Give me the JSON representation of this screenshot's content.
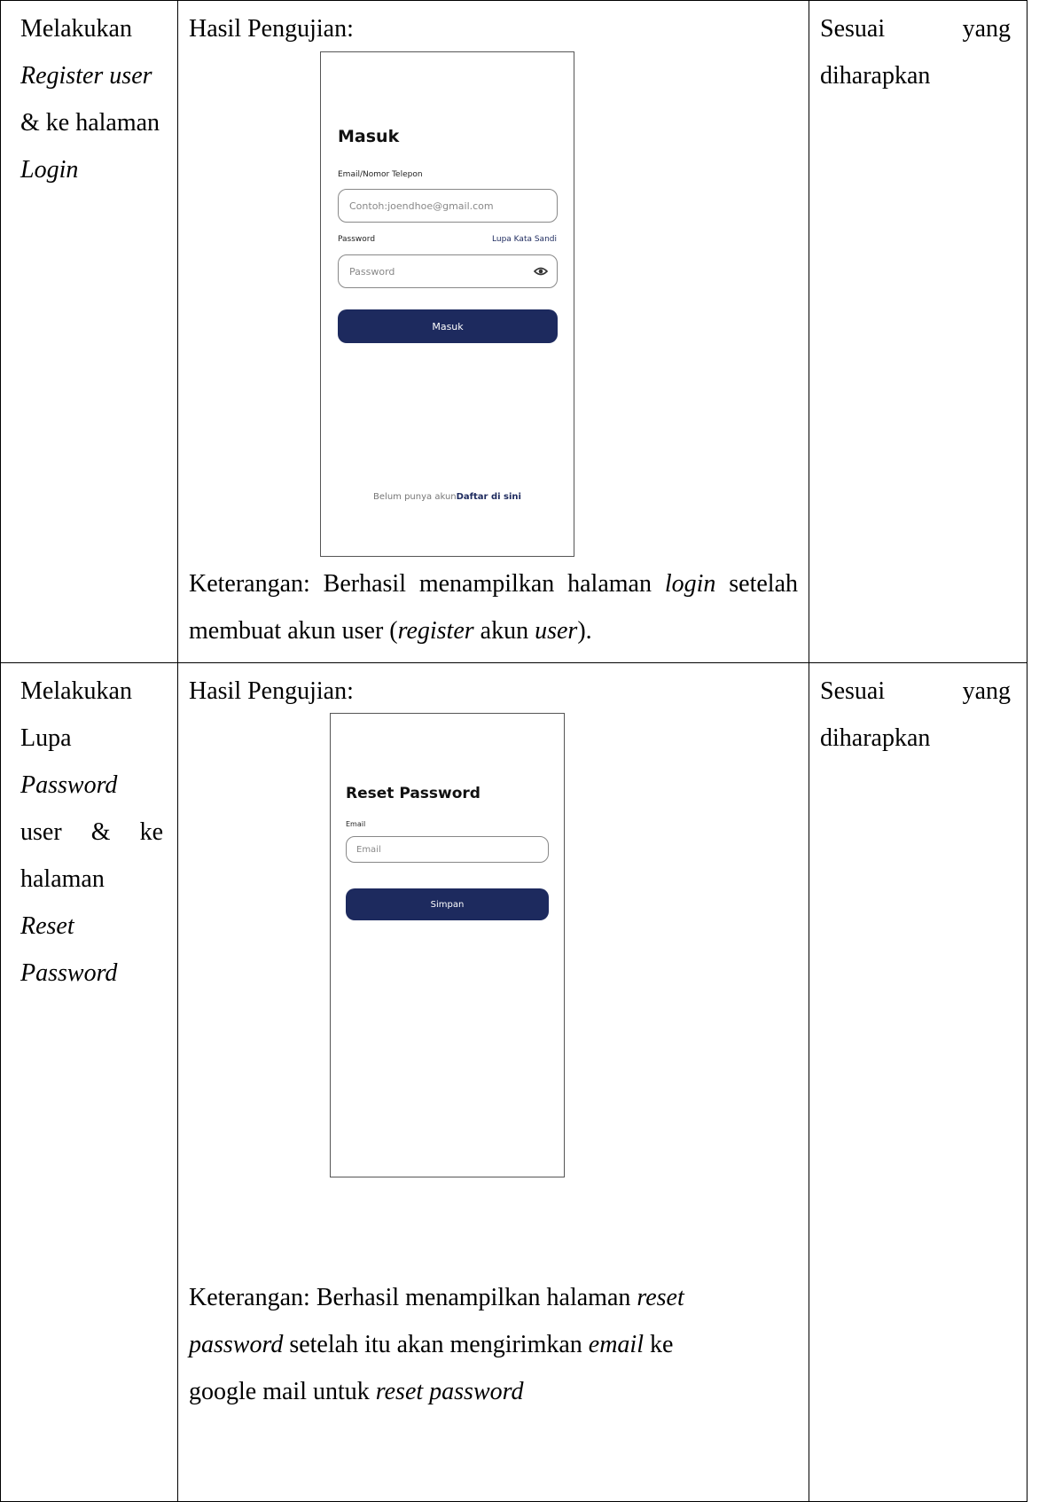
{
  "rows": [
    {
      "scenario": {
        "line1": "Melakukan",
        "line2": "Register user",
        "line3": "& ke halaman",
        "line4": "Login"
      },
      "result_label": "Hasil Pengujian:",
      "phone": {
        "title": "Masuk",
        "email_label": "Email/Nomor Telepon",
        "email_placeholder": "Contoh:joendhoe@gmail.com",
        "password_label": "Password",
        "forgot_link": "Lupa Kata Sandi",
        "password_placeholder": "Password",
        "submit": "Masuk",
        "footer_text": "Belum punya akun",
        "footer_link": "Daftar di sini",
        "eye_icon": "eye-icon"
      },
      "note": {
        "prefix": "Keterangan: Berhasil menampilkan halaman ",
        "login": "login",
        "mid": " setelah membuat akun user (",
        "register": "register",
        "akun": " akun ",
        "user": "user",
        "end": ")."
      },
      "status": {
        "word1": "Sesuai",
        "word2": "yang",
        "word3": "diharapkan"
      }
    },
    {
      "scenario": {
        "line1": "Melakukan",
        "line2": "Lupa",
        "line3": "Password",
        "line4a": "user",
        "line4b": "&",
        "line4c": "ke",
        "line5": "halaman",
        "line6": "Reset",
        "line7": "Password"
      },
      "result_label": "Hasil Pengujian:",
      "phone": {
        "title": "Reset Password",
        "email_label": "Email",
        "email_placeholder": "Email",
        "submit": "Simpan"
      },
      "note": {
        "prefix": "Keterangan: Berhasil menampilkan halaman ",
        "reset": "reset",
        "password": "password",
        "mid": " setelah itu akan mengirimkan ",
        "email": "email",
        "mid2": " ke",
        "line3a": "google mail untuk ",
        "line3b": "reset password"
      },
      "status": {
        "word1": "Sesuai",
        "word2": "yang",
        "word3": "diharapkan"
      }
    }
  ]
}
